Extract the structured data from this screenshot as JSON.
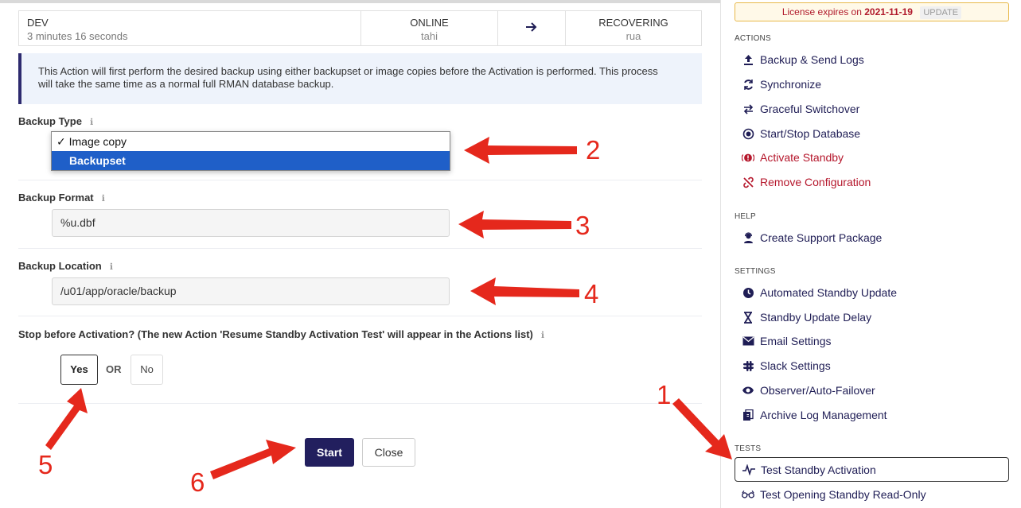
{
  "status": {
    "db_name": "DEV",
    "duration": "3 minutes 16 seconds",
    "primary_state": "ONLINE",
    "primary_host": "tahi",
    "standby_state": "RECOVERING",
    "standby_host": "rua"
  },
  "info_text": "This Action will first perform the desired backup using either backupset or image copies before the Activation is performed. This process will take the same time as a normal full RMAN database backup.",
  "form": {
    "backup_type_label": "Backup Type",
    "backup_type_options": [
      "Image copy",
      "Backupset"
    ],
    "backup_type_checked": "✓ Image copy",
    "backup_format_label": "Backup Format",
    "backup_format_value": "%u.dbf",
    "backup_location_label": "Backup Location",
    "backup_location_value": "/u01/app/oracle/backup",
    "stop_label": "Stop before Activation? (The new Action 'Resume Standby Activation Test' will appear in the Actions list)",
    "yes_label": "Yes",
    "or_label": "OR",
    "no_label": "No",
    "start_label": "Start",
    "close_label": "Close"
  },
  "sidebar": {
    "license_prefix": "License expires on",
    "license_date": "2021-11-19",
    "license_update": "UPDATE",
    "actions_title": "ACTIONS",
    "actions": [
      {
        "label": "Backup & Send Logs",
        "icon": "upload-icon"
      },
      {
        "label": "Synchronize",
        "icon": "sync-icon"
      },
      {
        "label": "Graceful Switchover",
        "icon": "switch-icon"
      },
      {
        "label": "Start/Stop Database",
        "icon": "power-icon"
      },
      {
        "label": "Activate Standby",
        "icon": "alert-icon"
      },
      {
        "label": "Remove Configuration",
        "icon": "unlink-icon"
      }
    ],
    "help_title": "HELP",
    "help": [
      {
        "label": "Create Support Package",
        "icon": "support-icon"
      }
    ],
    "settings_title": "SETTINGS",
    "settings": [
      {
        "label": "Automated Standby Update",
        "icon": "clock-icon"
      },
      {
        "label": "Standby Update Delay",
        "icon": "hourglass-icon"
      },
      {
        "label": "Email Settings",
        "icon": "envelope-icon"
      },
      {
        "label": "Slack Settings",
        "icon": "slack-icon"
      },
      {
        "label": "Observer/Auto-Failover",
        "icon": "eye-icon"
      },
      {
        "label": "Archive Log Management",
        "icon": "copy-icon"
      }
    ],
    "tests_title": "TESTS",
    "tests": [
      {
        "label": "Test Standby Activation",
        "icon": "pulse-icon"
      },
      {
        "label": "Test Opening Standby Read-Only",
        "icon": "glasses-icon"
      }
    ]
  },
  "annotations": [
    "1",
    "2",
    "3",
    "4",
    "5",
    "6"
  ],
  "colors": {
    "accent": "#221f5e",
    "danger": "#b5162b",
    "annotation": "#e5281c",
    "selection": "#1f5fc8"
  }
}
